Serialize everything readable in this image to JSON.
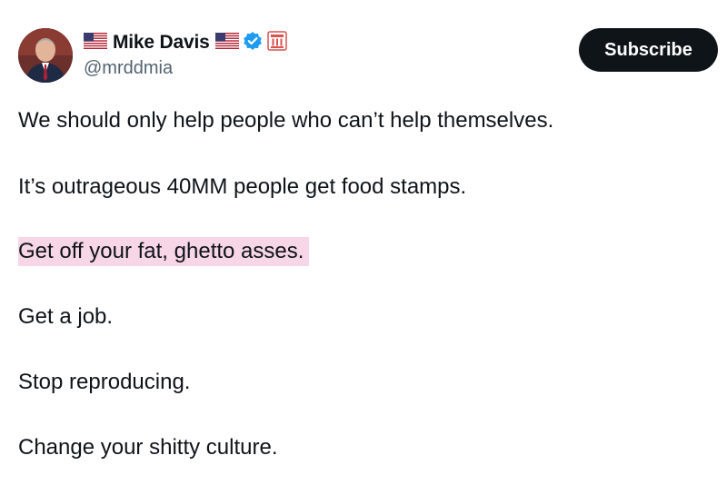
{
  "author": {
    "display_name": "Mike Davis",
    "handle": "@mrddmia",
    "verified": true,
    "flag_before": "us-flag-icon",
    "flag_after": "us-flag-icon",
    "org_badge": "government-building-badge-icon"
  },
  "actions": {
    "subscribe_label": "Subscribe"
  },
  "tweet": {
    "lines": [
      "We should only help people who can’t help themselves.",
      "It’s outrageous 40MM people get food stamps.",
      "Get off your fat, ghetto asses.",
      "Get a job.",
      "Stop reproducing.",
      "Change your shitty culture."
    ],
    "highlighted_line_index": 2
  },
  "colors": {
    "text": "#0f1419",
    "muted": "#536471",
    "subscribe_bg": "#0f1419",
    "highlight": "#f7d6e8",
    "verified_blue": "#1d9bf0"
  }
}
